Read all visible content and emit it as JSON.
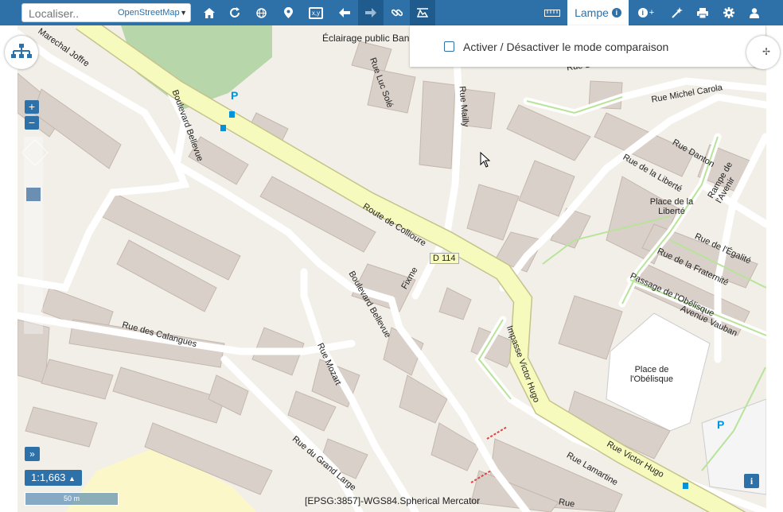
{
  "search": {
    "placeholder": "Localiser..",
    "source": "OpenStreetMap"
  },
  "toolbar": {
    "icons": [
      "home-icon",
      "refresh-icon",
      "globe-icon",
      "marker-icon",
      "coordinates-icon",
      "back-icon",
      "forward-icon",
      "link-icon",
      "compare-icon",
      "ruler-icon",
      "info-add-icon",
      "draw-icon",
      "print-icon",
      "settings-icon",
      "user-icon"
    ],
    "coordinates_label": "x,y",
    "active_tab": "Lampe",
    "info_plus": "+"
  },
  "panel": {
    "compare_label": "Activer / Désactiver le mode comparaison"
  },
  "map": {
    "poi": "Éclairage public Ban",
    "streets": [
      "Marechal Joffre",
      "Rue Luc Solé",
      "Rue Mailly",
      "Rue Michel Carola",
      "Rue Danton",
      "Rampe de l'Avenir",
      "Rue de la Liberté",
      "Boulevard Bellevue",
      "Route de Collioure",
      "D 114",
      "Fixme",
      "Place de la Liberté",
      "Rue de l'Égalité",
      "Rue de la Fraternité",
      "Passage de l'Obélisque",
      "Avenue Vauban",
      "Rue des Calangues",
      "Rue Mozart",
      "Impasse Victor Hugo",
      "Place de l'Obélisque",
      "Rue du Grand Large",
      "Rue Lamartine",
      "Rue Victor Hugo",
      "Rue De",
      "Rue"
    ],
    "parking": "P",
    "projection": "[EPSG:3857]-WGS84.Spherical Mercator"
  },
  "controls": {
    "zoom_in": "+",
    "zoom_out": "−",
    "scale": "1:1,663",
    "scale_caret": "▲",
    "scalebar": "50 m",
    "expand": "»",
    "info": "i"
  },
  "colors": {
    "toolbar": "#2d71a8",
    "road_primary": "#f6fabd",
    "green": "#add19e",
    "building": "#d9d0c9",
    "footway": "#c7e9a1"
  }
}
